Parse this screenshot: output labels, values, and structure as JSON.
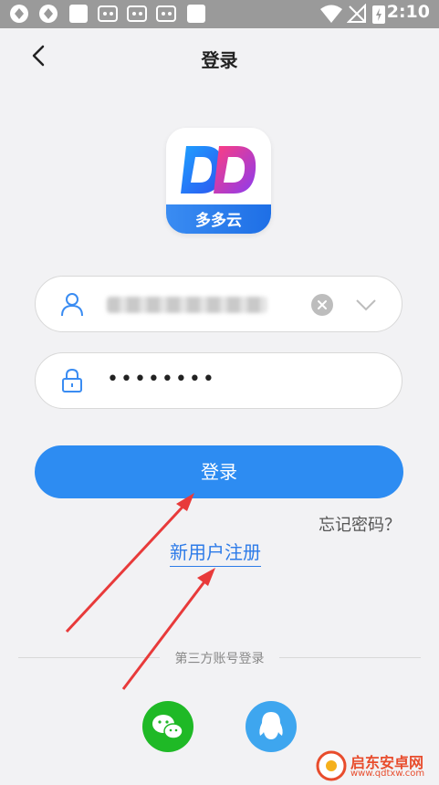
{
  "status_bar": {
    "time": "2:10"
  },
  "header": {
    "title": "登录"
  },
  "logo": {
    "initials": "DD",
    "name": "多多云"
  },
  "login_form": {
    "password_value": "••••••••",
    "login_button": "登录"
  },
  "links": {
    "forgot_password": "忘记密码？",
    "register": "新用户注册"
  },
  "third_party": {
    "label": "第三方账号登录"
  },
  "watermark": {
    "text": "启东安卓网",
    "url": "www.qdtxw.com"
  },
  "colors": {
    "accent": "#2d8cf2",
    "wechat": "#1fb926",
    "qq": "#3ea6ef",
    "arrow": "#e83a3a"
  }
}
